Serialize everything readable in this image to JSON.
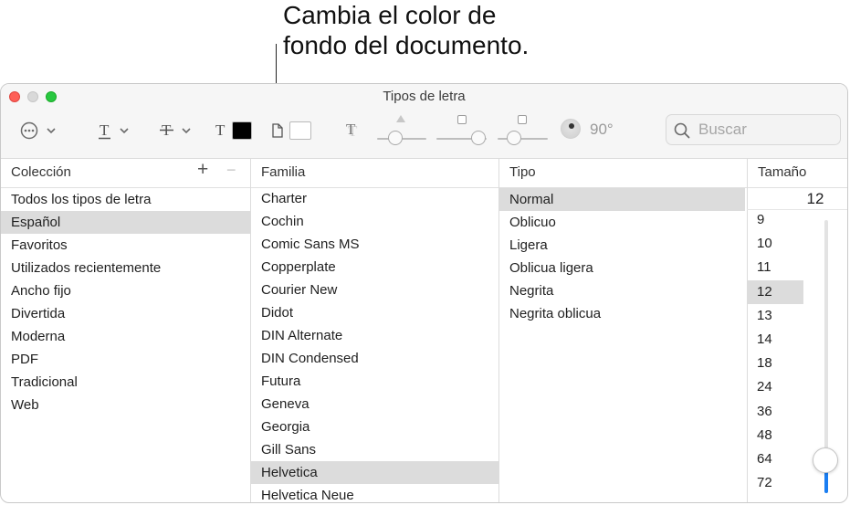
{
  "callout": {
    "line1": "Cambia el color de",
    "line2": "fondo del documento."
  },
  "window": {
    "title": "Tipos de letra"
  },
  "toolbar": {
    "angle_value": "90°",
    "text_color": "#000000",
    "document_color": "#ffffff"
  },
  "search": {
    "placeholder": "Buscar"
  },
  "columns": {
    "collection_header": "Colección",
    "family_header": "Familia",
    "type_header": "Tipo",
    "size_header": "Tamaño"
  },
  "collections": [
    "Todos los tipos de letra",
    "Español",
    "Favoritos",
    "Utilizados recientemente",
    "Ancho fijo",
    "Divertida",
    "Moderna",
    "PDF",
    "Tradicional",
    "Web"
  ],
  "collection_selected": "Español",
  "families": [
    "Charter",
    "Cochin",
    "Comic Sans MS",
    "Copperplate",
    "Courier New",
    "Didot",
    "DIN Alternate",
    "DIN Condensed",
    "Futura",
    "Geneva",
    "Georgia",
    "Gill Sans",
    "Helvetica",
    "Helvetica Neue"
  ],
  "family_selected": "Helvetica",
  "types": [
    "Normal",
    "Oblicuo",
    "Ligera",
    "Oblicua ligera",
    "Negrita",
    "Negrita oblicua"
  ],
  "type_selected": "Normal",
  "size": {
    "current": "12",
    "options": [
      "9",
      "10",
      "11",
      "12",
      "13",
      "14",
      "18",
      "24",
      "36",
      "48",
      "64",
      "72"
    ],
    "selected": "12",
    "slider_level_percent": 12
  }
}
